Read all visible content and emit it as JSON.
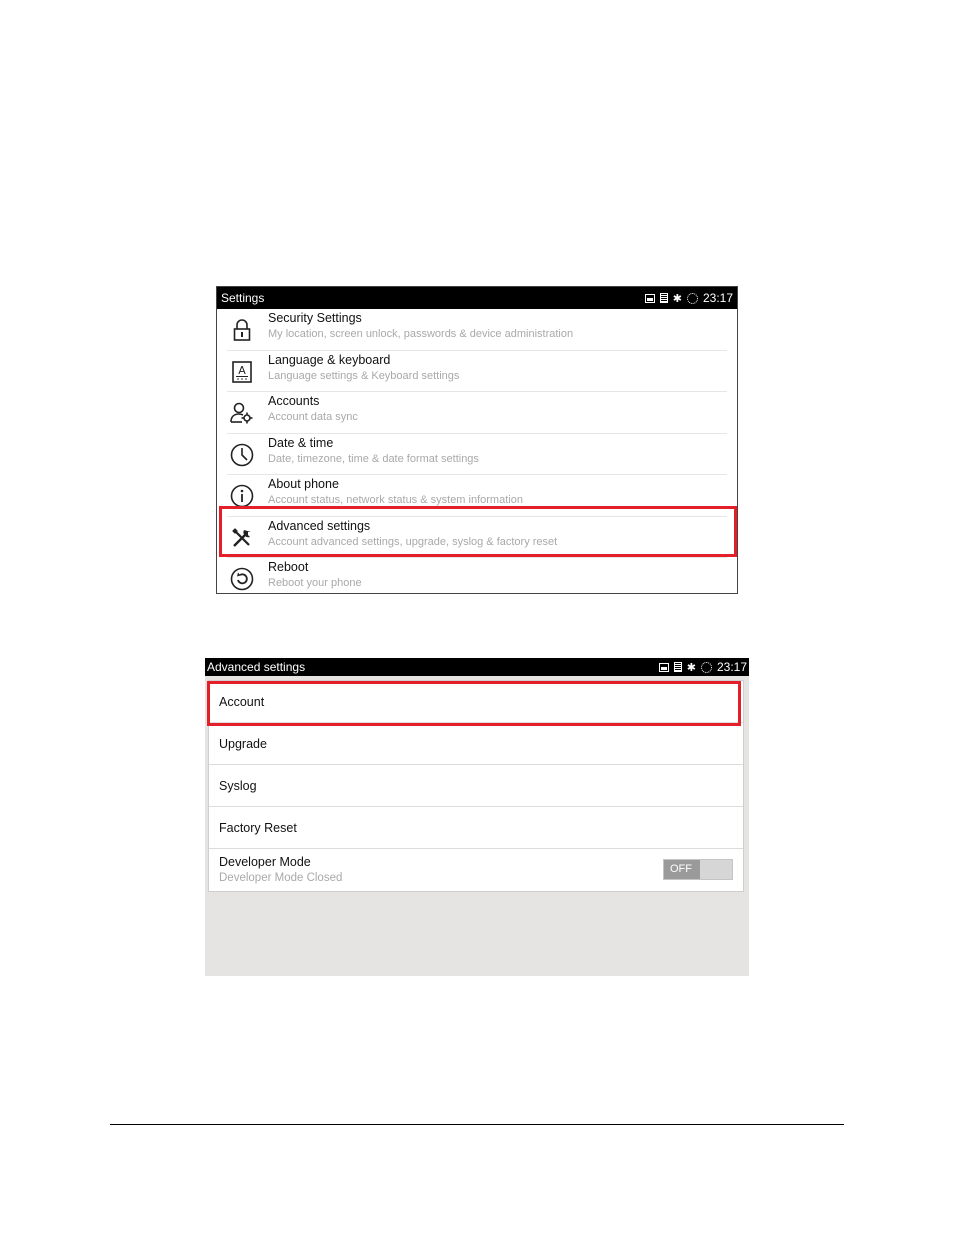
{
  "settings_screen": {
    "title": "Settings",
    "time": "23:17",
    "items": [
      {
        "title": "Security Settings",
        "subtitle": "My location, screen unlock, passwords & device administration",
        "icon": "lock-icon"
      },
      {
        "title": "Language & keyboard",
        "subtitle": "Language settings & Keyboard settings",
        "icon": "keyboard-icon"
      },
      {
        "title": "Accounts",
        "subtitle": "Account data sync",
        "icon": "accounts-icon"
      },
      {
        "title": "Date & time",
        "subtitle": "Date, timezone, time & date format settings",
        "icon": "clock-icon"
      },
      {
        "title": "About phone",
        "subtitle": "Account status, network status & system information",
        "icon": "info-icon"
      },
      {
        "title": "Advanced settings",
        "subtitle": "Account advanced settings, upgrade, syslog & factory reset",
        "icon": "tools-icon"
      },
      {
        "title": "Reboot",
        "subtitle": "Reboot your phone",
        "icon": "reboot-icon"
      }
    ],
    "highlighted_item": "Advanced settings"
  },
  "advanced_screen": {
    "title": "Advanced settings",
    "time": "23:17",
    "items": [
      {
        "label": "Account"
      },
      {
        "label": "Upgrade"
      },
      {
        "label": "Syslog"
      },
      {
        "label": "Factory Reset"
      }
    ],
    "developer_mode": {
      "title": "Developer Mode",
      "subtitle": "Developer Mode Closed",
      "toggle_label": "OFF"
    },
    "highlighted_item": "Account"
  },
  "colors": {
    "highlight_border": "#e3202a",
    "statusbar_bg": "#000000",
    "subtitle_text": "#a9a9a9"
  },
  "status_icons": [
    "picture-icon",
    "sim-icon",
    "bluetooth-icon",
    "sync-icon"
  ]
}
